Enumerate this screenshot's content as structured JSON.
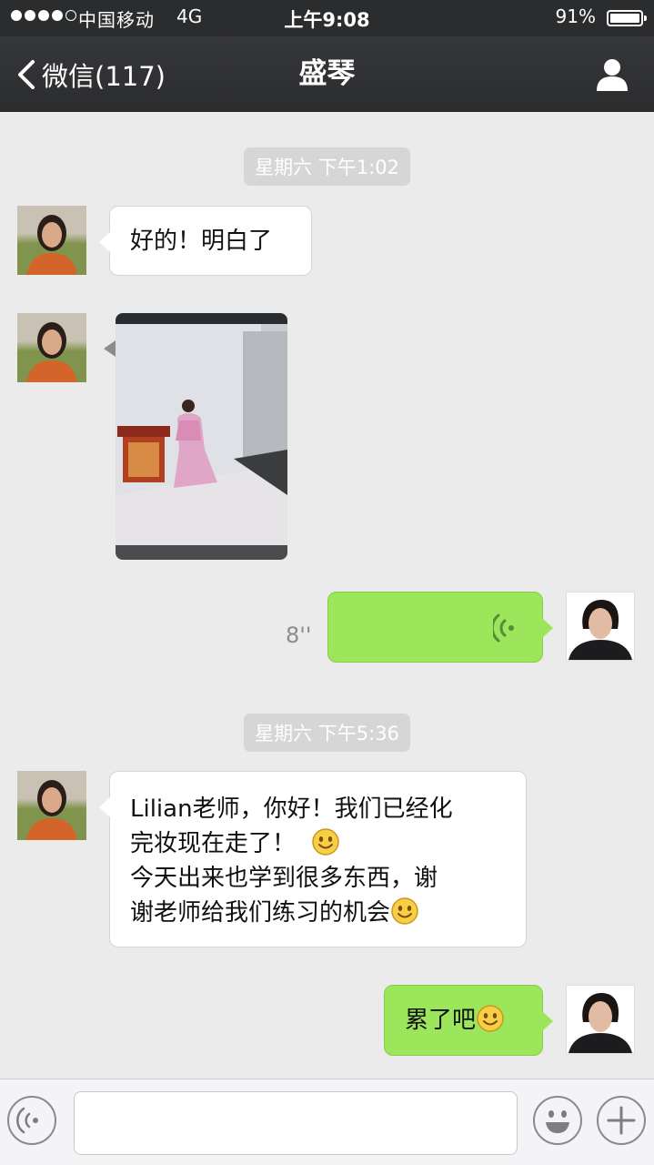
{
  "status_bar": {
    "carrier": "中国移动",
    "network": "4G",
    "time": "上午9:08",
    "battery": "91%",
    "battery_level": 0.91,
    "signal_bars": 4
  },
  "nav": {
    "back_label": "微信(117)",
    "title": "盛琴",
    "icons": [
      "chevron-left-icon",
      "person-icon"
    ]
  },
  "messages": {
    "ts1": "星期六 下午1:02",
    "m1": "好的！明白了",
    "voice_duration": "8''",
    "ts2": "星期六 下午5:36",
    "m4_line1": "Lilian老师，你好！我们已经化",
    "m4_line2": "完妆现在走了！",
    "m4_line3": "今天出来也学到很多东西，谢",
    "m4_line4": "谢老师给我们练习的机会",
    "m5": "累了吧"
  },
  "input_bar": {
    "placeholder": "",
    "icons": [
      "voice-icon",
      "emoji-icon",
      "plus-icon"
    ]
  },
  "colors": {
    "nav_bg": "#2b2c2e",
    "chat_bg": "#ebebeb",
    "outgoing_bubble": "#9be65a",
    "incoming_bubble": "#ffffff"
  }
}
